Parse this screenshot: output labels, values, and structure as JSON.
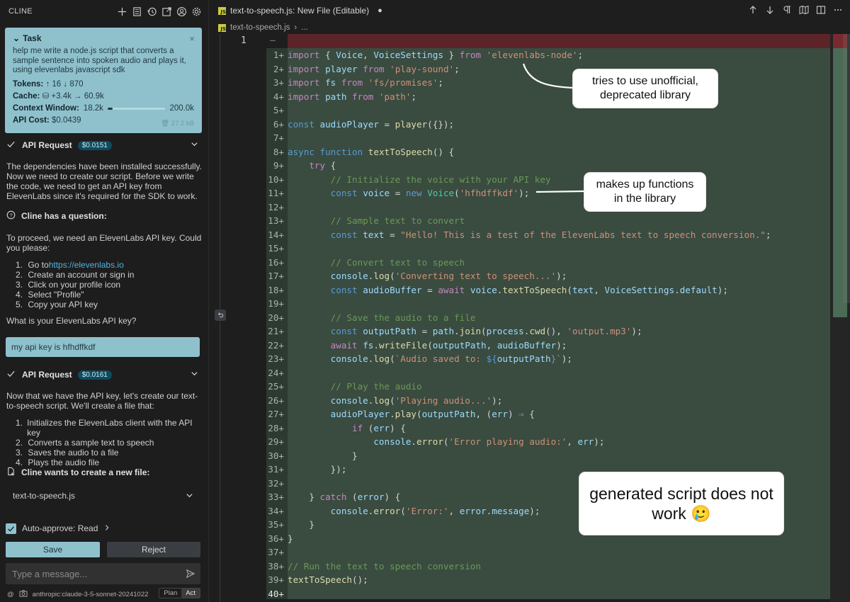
{
  "sidebar": {
    "title": "CLINE",
    "header_icons": [
      "plus-icon",
      "history-list-icon",
      "history-icon",
      "popout-icon",
      "account-icon",
      "gear-icon"
    ],
    "task": {
      "label": "Task",
      "close": "×",
      "text": "help me write a node.js script that converts a sample sentence into spoken audio and plays it, using elevenlabs javascript sdk",
      "tokens_label": "Tokens:",
      "tokens_in": "↑ 16",
      "tokens_out": "↓ 870",
      "cache_label": "Cache:",
      "cache_value": "⛁ +3.4k → 60.9k",
      "context_label": "Context Window:",
      "context_used": "18.2k",
      "context_max": "200.0k",
      "context_fraction": 0.091,
      "api_cost_label": "API Cost:",
      "api_cost": "$0.0439",
      "size": "27.2 kB"
    },
    "api_request_1": {
      "label": "API Request",
      "cost": "$0.0151"
    },
    "msg1": "The dependencies have been installed successfully. Now we need to create our script. Before we write the code, we need to get an API key from ElevenLabs since it's required for the SDK to work.",
    "question_label": "Cline has a question:",
    "question_intro": "To proceed, we need an ElevenLabs API key. Could you please:",
    "steps": [
      {
        "num": "1.",
        "text_pre": "Go to ",
        "link": "https://elevenlabs.io"
      },
      {
        "num": "2.",
        "text": "Create an account or sign in"
      },
      {
        "num": "3.",
        "text": "Click on your profile icon"
      },
      {
        "num": "4.",
        "text": "Select \"Profile\""
      },
      {
        "num": "5.",
        "text": "Copy your API key"
      }
    ],
    "question_end": "What is your ElevenLabs API key?",
    "user_reply": "my api key is hfhdffkdf",
    "api_request_2": {
      "label": "API Request",
      "cost": "$0.0161"
    },
    "msg2": "Now that we have the API key, let's create our text-to-speech script. We'll create a file that:",
    "plan": [
      {
        "num": "1.",
        "text": "Initializes the ElevenLabs client with the API key"
      },
      {
        "num": "2.",
        "text": "Converts a sample text to speech"
      },
      {
        "num": "3.",
        "text": "Saves the audio to a file"
      },
      {
        "num": "4.",
        "text": "Plays the audio file"
      }
    ],
    "create_file_label": "Cline wants to create a new file:",
    "file_name": "text-to-speech.js",
    "auto_approve": "Auto-approve: Read",
    "save_label": "Save",
    "reject_label": "Reject",
    "input_placeholder": "Type a message...",
    "model": "anthropic:claude-3-5-sonnet-20241022",
    "mode_plan": "Plan",
    "mode_act": "Act"
  },
  "editor": {
    "tab_title": "text-to-speech.js: New File (Editable)",
    "tab_dot": "●",
    "breadcrumb_file": "text-to-speech.js",
    "breadcrumb_rest": "...",
    "original_line": "1",
    "removed_marker": "—",
    "line_numbers": [
      "1+",
      "2+",
      "3+",
      "4+",
      "5+",
      "6+",
      "7+",
      "8+",
      "9+",
      "10+",
      "11+",
      "12+",
      "13+",
      "14+",
      "15+",
      "16+",
      "17+",
      "18+",
      "19+",
      "20+",
      "21+",
      "22+",
      "23+",
      "24+",
      "25+",
      "26+",
      "27+",
      "28+",
      "29+",
      "30+",
      "31+",
      "32+",
      "33+",
      "34+",
      "35+",
      "36+",
      "37+",
      "38+",
      "39+",
      "40+"
    ]
  },
  "callouts": {
    "c1": "tries to use unofficial, deprecated library",
    "c2": "makes up functions in the library",
    "c3": "generated script does not work 🥲"
  },
  "colors": {
    "accent": "#8fc1cd",
    "added_bg": "#3a4b40",
    "removed_bg": "#5c2428",
    "sidebar_bg": "#1d1d1d",
    "editor_bg": "#1e1e1e"
  }
}
